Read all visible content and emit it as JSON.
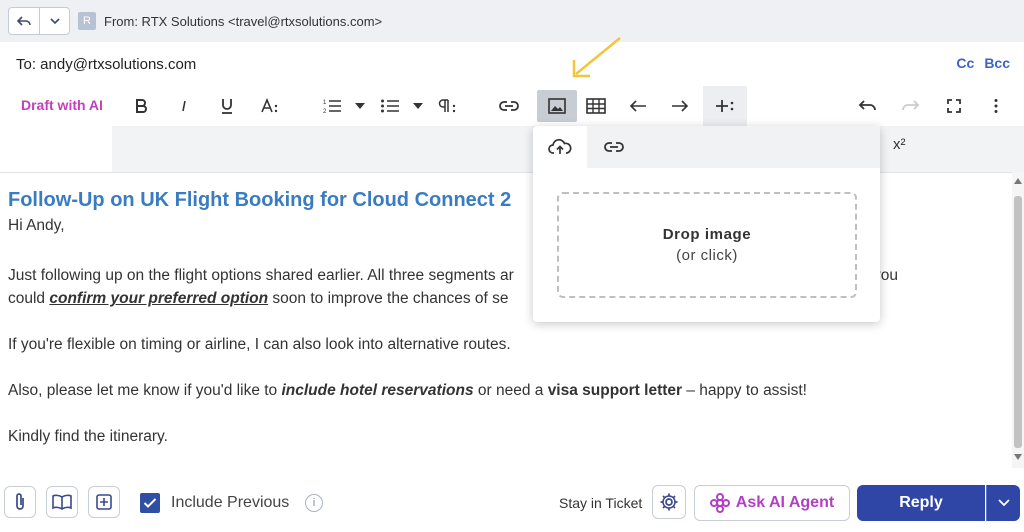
{
  "header": {
    "avatar_letter": "R",
    "from": "From:  RTX Solutions <travel@rtxsolutions.com>"
  },
  "recipients": {
    "to": "To: andy@rtxsolutions.com",
    "cc_label": "Cc",
    "bcc_label": "Bcc"
  },
  "toolbar": {
    "draft_ai_label": "Draft with AI",
    "draft_ai_color": "#c33fbf",
    "buttons": [
      "bold",
      "italic",
      "underline",
      "font-size",
      "ordered-list",
      "bulleted-list",
      "paragraph",
      "link",
      "image",
      "table",
      "undo-arrow",
      "redo-arrow",
      "more",
      "undo",
      "redo",
      "fullscreen",
      "overflow"
    ],
    "superscript_label": "x²",
    "active_button": "image"
  },
  "image_popup": {
    "tabs": [
      "upload",
      "link"
    ],
    "drop_title": "Drop image",
    "drop_subtitle": "(or click)"
  },
  "email": {
    "subject": "Follow-Up on UK Flight Booking for Cloud Connect 2",
    "greeting": "Hi Andy,",
    "p1_line1": "Just following up on the flight options shared earlier. All three segments ar",
    "p1_line1_tail": "you",
    "p1_line2_pre": "could ",
    "p1_line2_em": "confirm your preferred option",
    "p1_line2_post": " soon to improve the chances of se",
    "p2": "If you're flexible on timing or airline, I can also look into alternative routes.",
    "p3_pre": "Also, please let me know if you'd like to ",
    "p3_em": "include hotel reservations",
    "p3_mid": " or need a ",
    "p3_bold": "visa support letter",
    "p3_post": " – happy to assist!",
    "p4": "Kindly find the itinerary.",
    "subject_color": "#3a7cc1"
  },
  "footer": {
    "include_previous_label": "Include Previous",
    "include_previous_checked": true,
    "info_symbol": "i",
    "stay_label": "Stay in Ticket",
    "ask_ai_label": "Ask AI Agent",
    "reply_label": "Reply",
    "reply_color": "#2f46a6"
  }
}
